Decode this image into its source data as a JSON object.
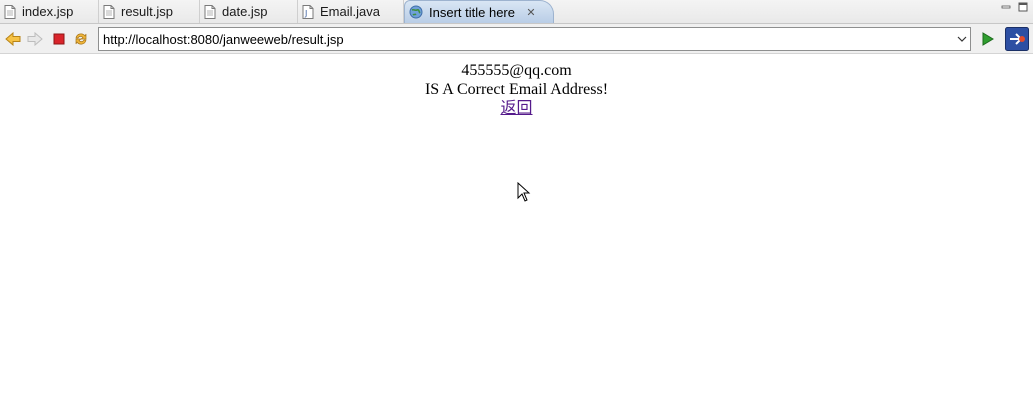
{
  "tabs": [
    {
      "label": "index.jsp",
      "icon": "jsp-file-icon",
      "active": false
    },
    {
      "label": "result.jsp",
      "icon": "jsp-file-icon",
      "active": false
    },
    {
      "label": "date.jsp",
      "icon": "jsp-file-icon",
      "active": false
    },
    {
      "label": "Email.java",
      "icon": "java-file-icon",
      "active": false
    },
    {
      "label": "Insert title here",
      "icon": "globe-icon",
      "active": true
    }
  ],
  "toolbar": {
    "url": "http://localhost:8080/janweeweb/result.jsp",
    "buttons": [
      "back-icon",
      "forward-icon",
      "stop-icon",
      "refresh-icon",
      "go-icon",
      "external-browser-icon"
    ]
  },
  "page": {
    "email": "455555@qq.com",
    "message": "IS A Correct Email Address!",
    "back_link": "返回"
  },
  "colors": {
    "active_tab": "#c8d9ee",
    "link_visited": "#551a8b",
    "stop_red": "#d9242b",
    "go_green": "#2f9e2f"
  }
}
